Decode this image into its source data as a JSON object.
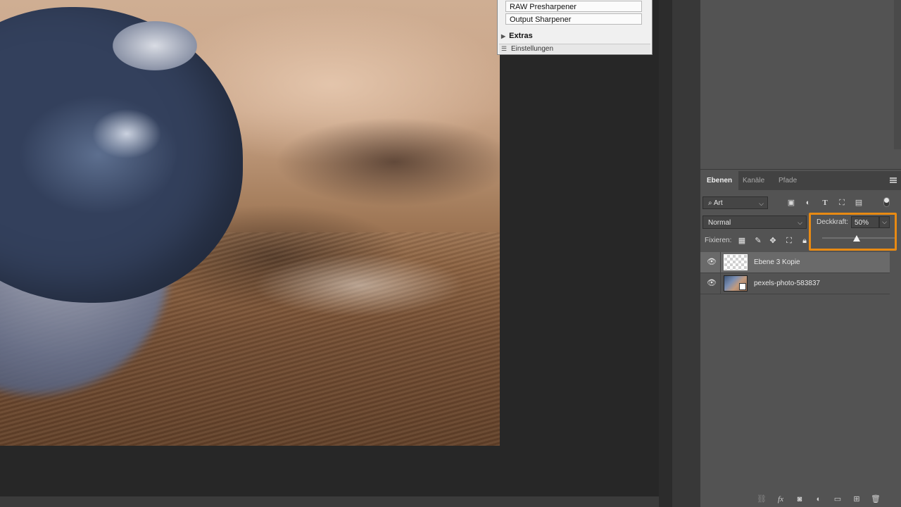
{
  "plugin": {
    "buttons": [
      "RAW Presharpener",
      "Output Sharpener"
    ],
    "extras_label": "Extras",
    "settings_label": "Einstellungen"
  },
  "layers_panel": {
    "tabs": [
      "Ebenen",
      "Kanäle",
      "Pfade"
    ],
    "active_tab": "Ebenen",
    "filter_select": "Art",
    "blend_mode": "Normal",
    "opacity_label": "Deckkraft:",
    "opacity_value": "50%",
    "opacity_level_percent": 50,
    "lock_label": "Fixieren:",
    "layers": [
      {
        "name": "Ebene 3 Kopie",
        "visible": true,
        "selected": true
      },
      {
        "name": "pexels-photo-583837",
        "visible": true,
        "selected": false
      }
    ],
    "highlight_color": "#e88a13",
    "filter_icons": [
      "image-filter-icon",
      "adjustment-filter-icon",
      "type-filter-icon",
      "shape-filter-icon",
      "smart-object-filter-icon"
    ],
    "lock_icons": [
      "lock-transparent-icon",
      "lock-image-icon",
      "lock-position-icon",
      "lock-artboard-icon",
      "lock-all-icon"
    ],
    "footer_icons": [
      "link-icon",
      "fx-icon",
      "mask-icon",
      "adjustment-layer-icon",
      "group-icon",
      "new-layer-icon",
      "trash-icon"
    ]
  }
}
